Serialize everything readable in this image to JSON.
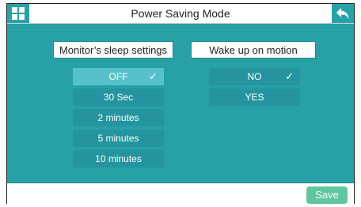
{
  "header": {
    "title": "Power Saving Mode",
    "home_icon": "grid-icon",
    "back_icon": "back-arrow-icon"
  },
  "sleep_settings": {
    "header": "Monitor’s sleep settings",
    "options": [
      "OFF",
      "30 Sec",
      "2 minutes",
      "5 minutes",
      "10 minutes"
    ],
    "selected": "OFF"
  },
  "wake_motion": {
    "header": "Wake up on motion",
    "options": [
      "NO",
      "YES"
    ],
    "selected": "NO"
  },
  "footer": {
    "save_label": "Save"
  },
  "check_mark": "✓",
  "colors": {
    "accent": "#27a0a6",
    "button_dark": "#2495a0",
    "button_selected": "#56c1cb",
    "save": "#5fc79d"
  }
}
